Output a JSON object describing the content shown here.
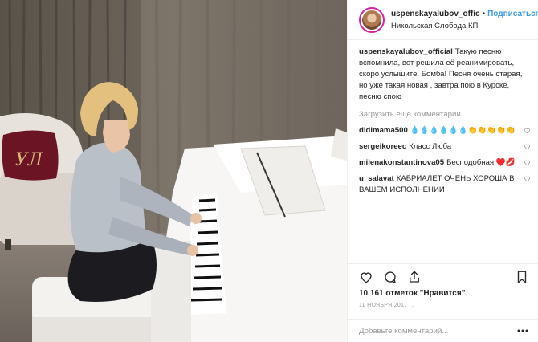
{
  "post": {
    "username": "uspenskayalubov_offic",
    "separator": "•",
    "follow_label": "Подписаться",
    "location": "Никольская Слобода КП"
  },
  "caption": {
    "username": "uspenskayalubov_official",
    "text": "Такую песню вспомнила, вот решила её реанимировать, скоро услышите. Бомба! Песня очень старая, но уже такая новая , завтра пою в Курске, песню спою"
  },
  "load_more_label": "Загрузить еще комментарии",
  "comments": [
    {
      "username": "didimama500",
      "text": "💧💧💧💧💧💧👏👏👏👏👏"
    },
    {
      "username": "sergeikoreec",
      "text": "Класс Люба"
    },
    {
      "username": "milenakonstantinova05",
      "text": "Бесподобная ♥️💋"
    },
    {
      "username": "u_salavat",
      "text": "КАБРИАЛЕТ ОЧЕНЬ ХОРОША В ВАШЕМ ИСПОЛНЕНИИ"
    }
  ],
  "likes_text": "10 161 отметок \"Нравится\"",
  "date_text": "11 НОЯБРЯ 2017 Г.",
  "add_comment_placeholder": "Добавьте комментарий...",
  "photo": {
    "monogram": "УЛ"
  },
  "colors": {
    "link": "#3897f0",
    "muted": "#999999",
    "text": "#262626"
  }
}
